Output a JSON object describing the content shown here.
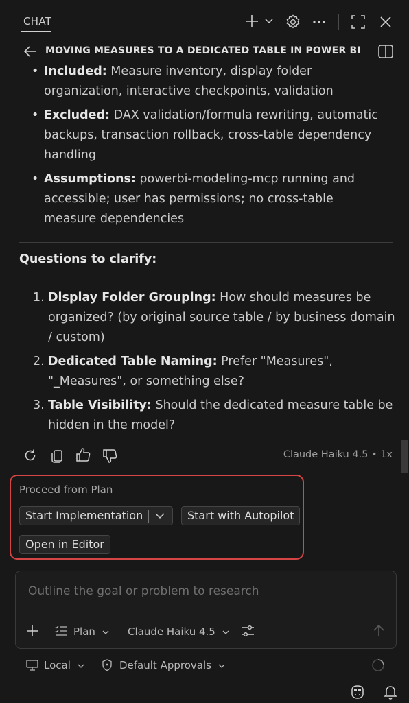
{
  "header": {
    "tab": "CHAT",
    "icons": [
      "plus-icon",
      "chevron-down-icon",
      "gear-icon",
      "more-icon",
      "maximize-icon",
      "close-icon"
    ]
  },
  "title_bar": {
    "title": "MOVING MEASURES TO A DEDICATED TABLE IN POWER BI",
    "icons": [
      "back-arrow-icon",
      "panel-icon"
    ]
  },
  "scope": [
    {
      "label": "Included:",
      "text": " Measure inventory, display folder organization, interactive checkpoints, validation"
    },
    {
      "label": "Excluded:",
      "text": " DAX validation/formula rewriting, automatic backups, transaction rollback, cross-table dependency handling"
    },
    {
      "label": "Assumptions:",
      "text": " powerbi-modeling-mcp running and accessible; user has permissions; no cross-table measure dependencies"
    }
  ],
  "questions": {
    "heading": "Questions to clarify:",
    "items": [
      {
        "num": "1.",
        "label": "Display Folder Grouping:",
        "text": " How should measures be organized? (by original source table / by business domain / custom)"
      },
      {
        "num": "2.",
        "label": "Dedicated Table Naming:",
        "text": " Prefer \"Measures\", \"_Measures\", or something else?"
      },
      {
        "num": "3.",
        "label": "Table Visibility:",
        "text": " Should the dedicated measure table be hidden in the model?"
      }
    ]
  },
  "response_actions": {
    "icons": [
      "retry-icon",
      "copy-icon",
      "thumbs-up-icon",
      "thumbs-down-icon"
    ],
    "model_info": "Claude Haiku 4.5 • 1x"
  },
  "proceed": {
    "label": "Proceed from Plan",
    "start_impl": "Start Implementation",
    "start_autopilot": "Start with Autopilot",
    "open_editor": "Open in Editor",
    "highlight_color": "#d64545"
  },
  "input": {
    "placeholder": "Outline the goal or problem to research",
    "value": "",
    "mode": "Plan",
    "model": "Claude Haiku 4.5"
  },
  "bottom": {
    "local": "Local",
    "approvals": "Default Approvals"
  },
  "colors": {
    "background": "#181818",
    "text": "#cccccc",
    "accent_red": "#d64545"
  }
}
